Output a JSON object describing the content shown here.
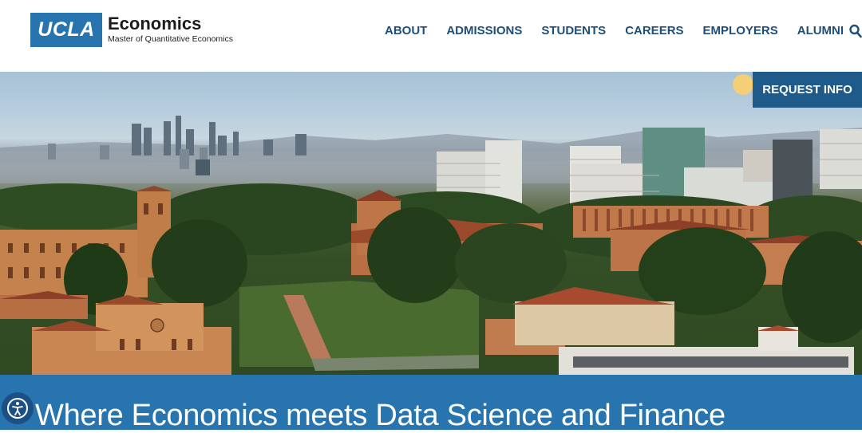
{
  "header": {
    "logo_mark": "UCLA",
    "logo_title": "Economics",
    "logo_subtitle": "Master of Quantitative Economics",
    "nav": [
      {
        "label": "ABOUT"
      },
      {
        "label": "ADMISSIONS"
      },
      {
        "label": "STUDENTS"
      },
      {
        "label": "CAREERS"
      },
      {
        "label": "EMPLOYERS"
      },
      {
        "label": "ALUMNI"
      }
    ],
    "search_icon": "search-icon"
  },
  "hero": {
    "image": "ucla-campus-aerial-photo",
    "cta_label": "REQUEST INFO"
  },
  "banner": {
    "headline": "Where Economics meets Data Science and Finance"
  },
  "accessibility": {
    "icon": "accessibility-icon"
  },
  "colors": {
    "brand_blue": "#2774ae",
    "nav_text": "#1e4e79",
    "cta_bg": "#1e5a8a"
  }
}
